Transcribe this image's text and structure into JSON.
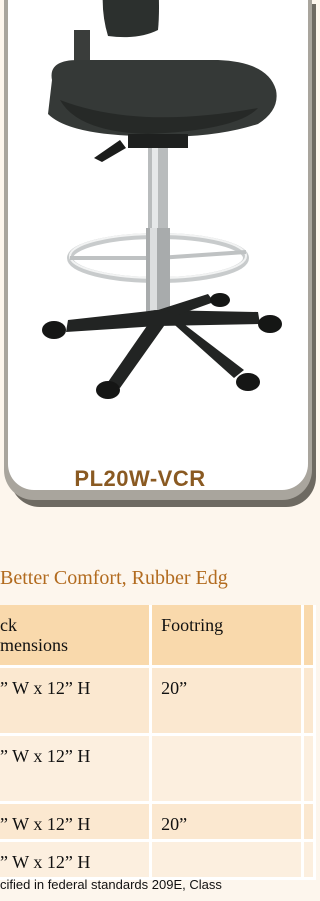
{
  "product": {
    "model_label": "PL20W-VCR",
    "image_alt": "black vinyl drafting chair with chrome footring and five-star base"
  },
  "section": {
    "heading": "Better Comfort, Rubber Edg"
  },
  "spec_table": {
    "headers": [
      "ck\nmensions",
      "Footring",
      ""
    ],
    "rows": [
      {
        "back": "” W x 12” H",
        "footring": "20”",
        "extra": ""
      },
      {
        "back": "” W x 12” H",
        "footring": "",
        "extra": ""
      },
      {
        "back": "” W x 12” H",
        "footring": "20”",
        "extra": ""
      },
      {
        "back": "” W x 12” H",
        "footring": "",
        "extra": ""
      }
    ]
  },
  "footnote": "cified in federal standards 209E, Class",
  "colors": {
    "page_bg": "#fdf6ed",
    "heading": "#b26b1f",
    "model_label": "#8a5a22",
    "table_header": "#f9d9ac"
  }
}
